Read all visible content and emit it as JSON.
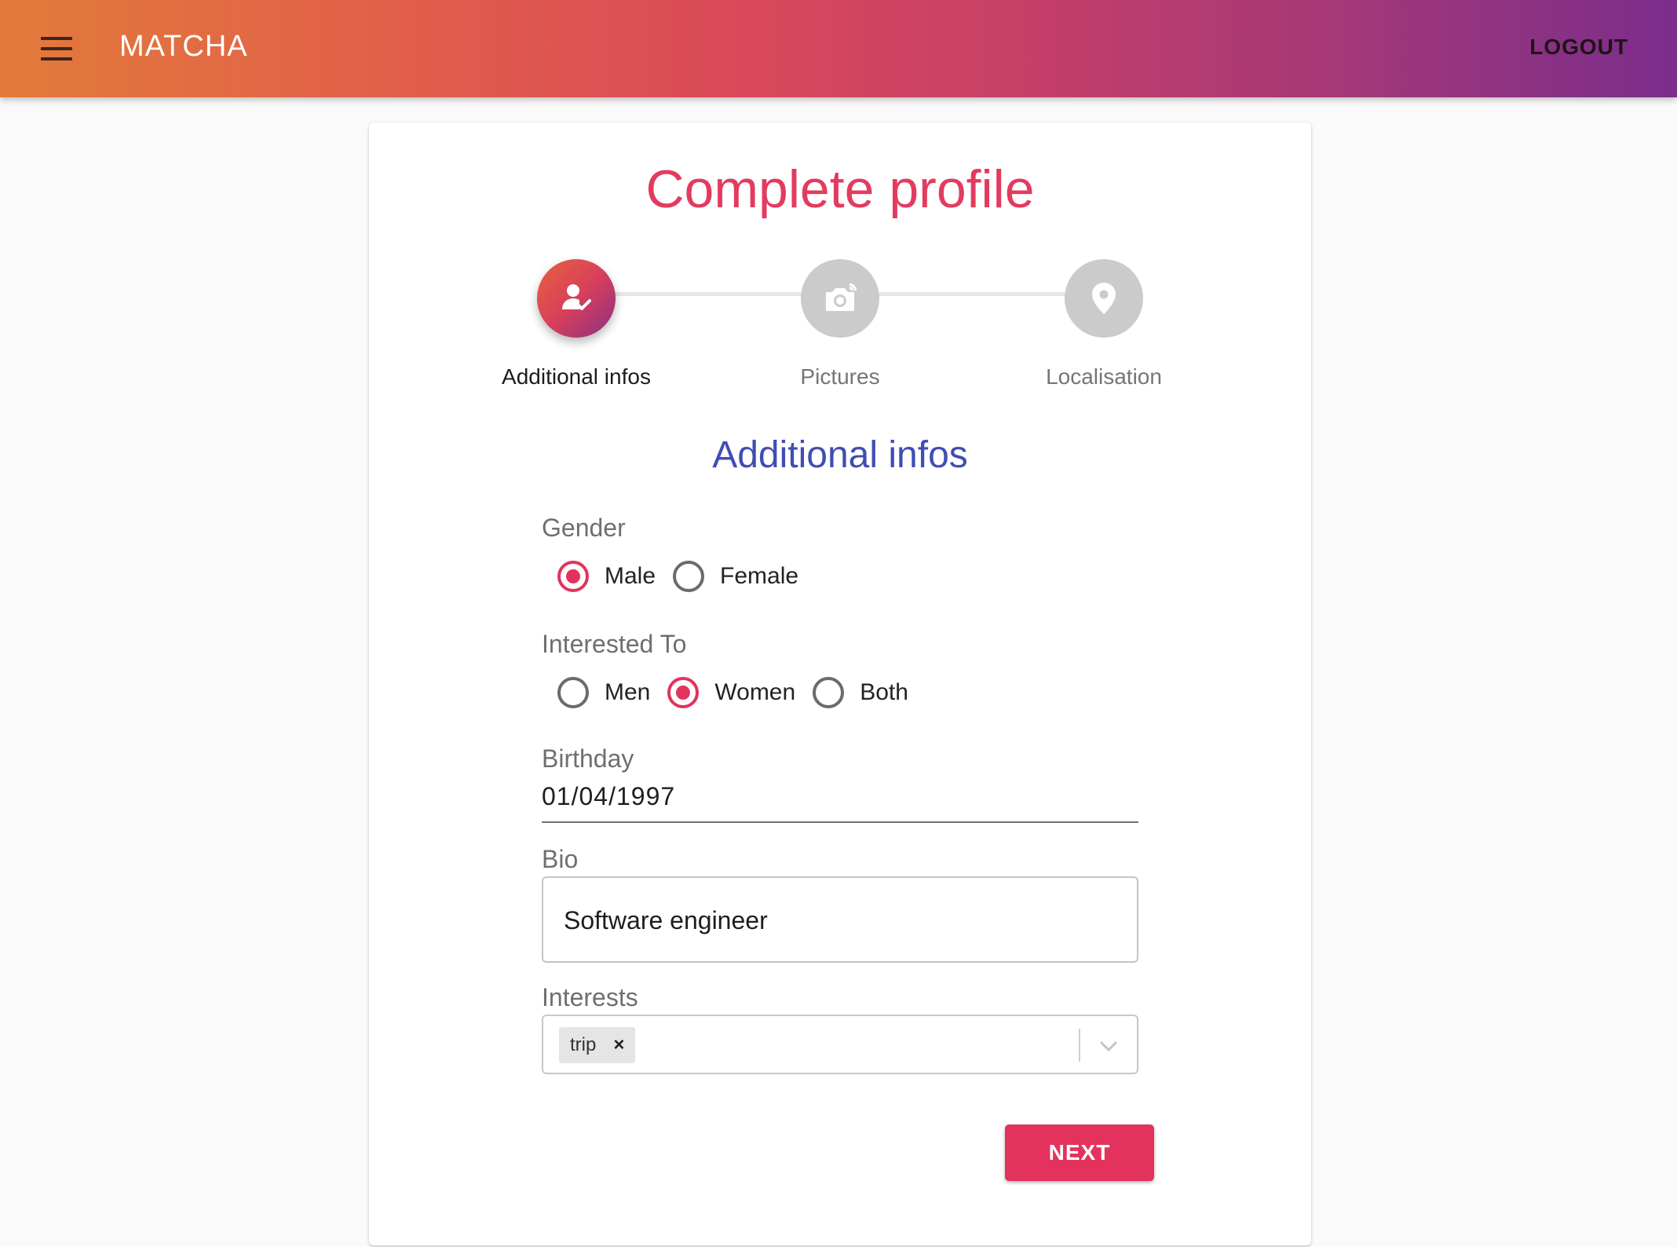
{
  "appbar": {
    "brand": "MATCHA",
    "logout_label": "LOGOUT"
  },
  "page": {
    "title": "Complete profile",
    "section_title": "Additional infos"
  },
  "stepper": {
    "steps": [
      {
        "label": "Additional infos",
        "icon": "person-check-icon",
        "state": "active"
      },
      {
        "label": "Pictures",
        "icon": "camera-icon",
        "state": "inactive"
      },
      {
        "label": "Localisation",
        "icon": "location-pin-icon",
        "state": "inactive"
      }
    ]
  },
  "form": {
    "gender": {
      "label": "Gender",
      "options": [
        "Male",
        "Female"
      ],
      "selected": "Male"
    },
    "interested_to": {
      "label": "Interested To",
      "options": [
        "Men",
        "Women",
        "Both"
      ],
      "selected": "Women"
    },
    "birthday": {
      "label": "Birthday",
      "value": "01/04/1997"
    },
    "bio": {
      "label": "Bio",
      "value": "Software engineer"
    },
    "interests": {
      "label": "Interests",
      "chips": [
        "trip"
      ],
      "chip_remove": "×"
    },
    "next_label": "NEXT"
  },
  "colors": {
    "accent": "#e3335c",
    "section_title": "#3f4db4",
    "appbar_gradient_start": "#e37a3a",
    "appbar_gradient_end": "#7a2d8b"
  }
}
